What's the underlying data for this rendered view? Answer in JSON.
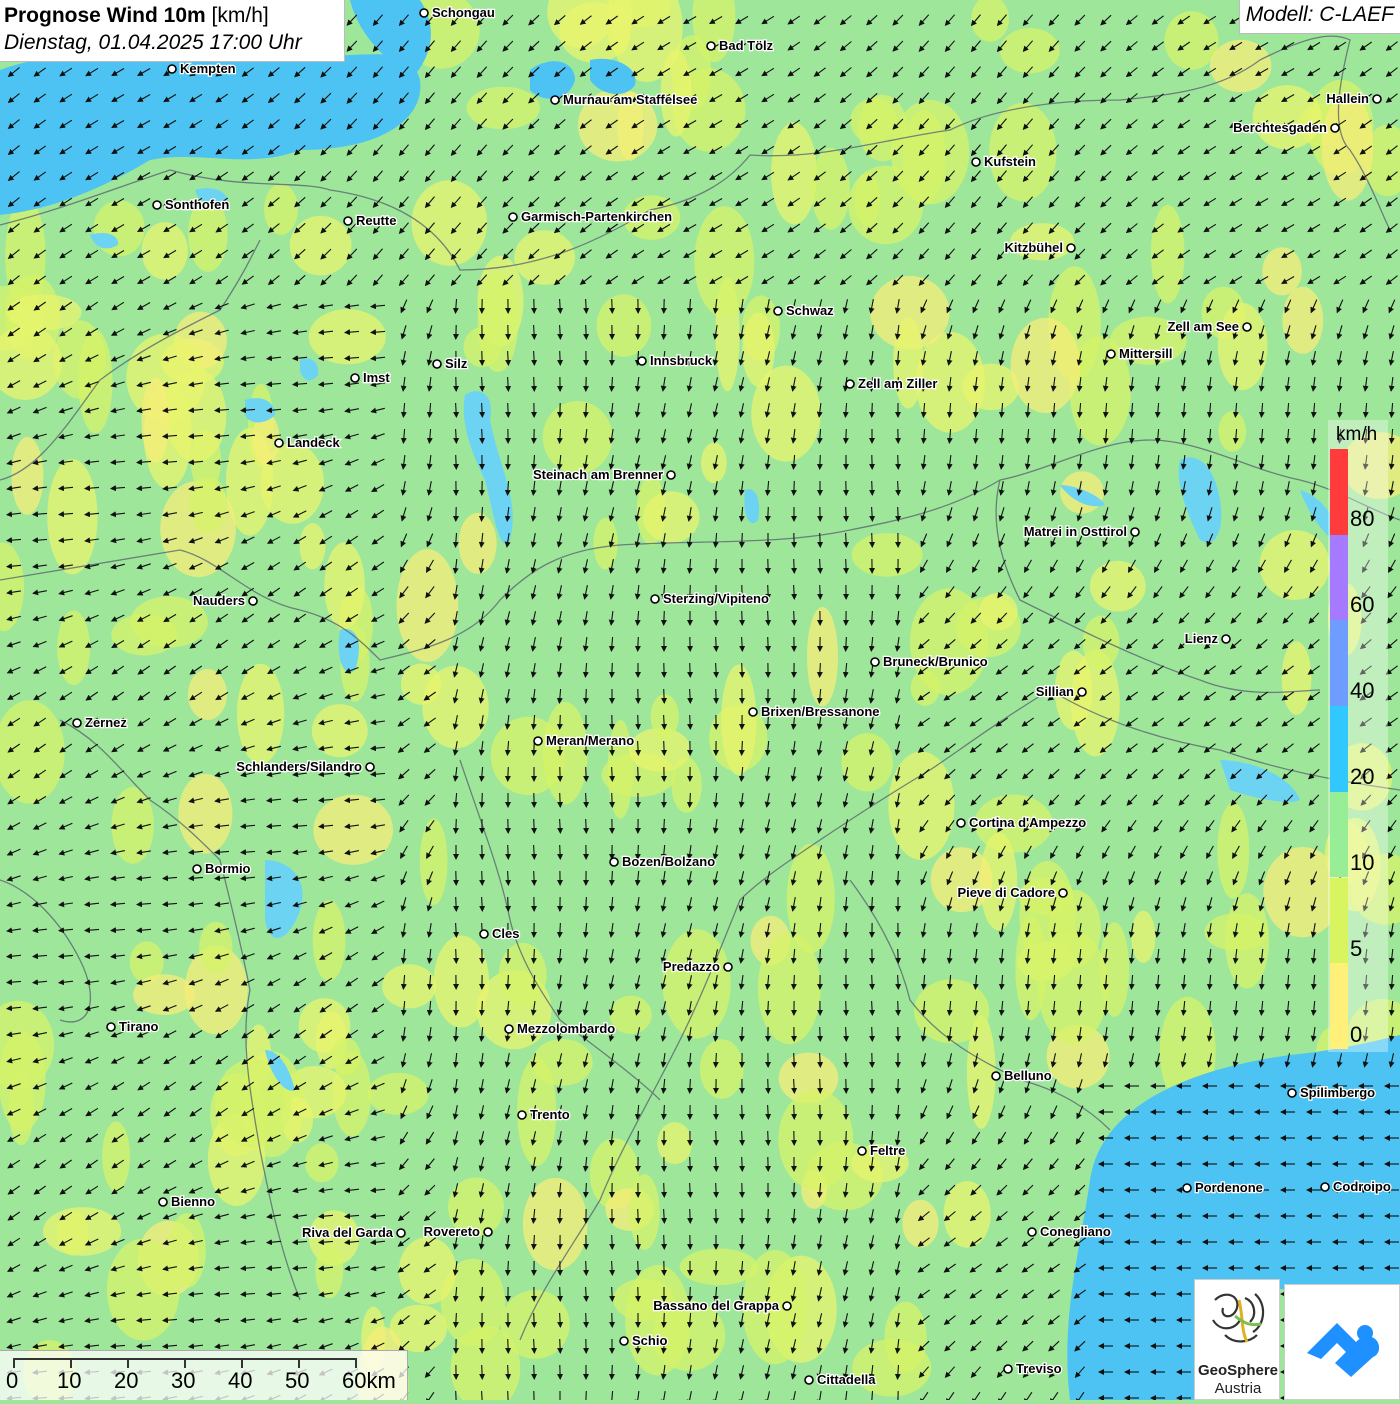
{
  "title": {
    "main": "Prognose Wind 10m",
    "unit": "[km/h]",
    "date": "Dienstag, 01.04.2025 17:00 Uhr"
  },
  "model": "Modell: C-LAEF",
  "legend": {
    "unit": "km/h",
    "labels": [
      "80",
      "60",
      "40",
      "20",
      "10",
      "5",
      "0"
    ],
    "colors": [
      "#ff3b3b",
      "#a67aff",
      "#6e9cff",
      "#30c8ff",
      "#98ee96",
      "#d8f560",
      "#fff07a"
    ]
  },
  "scale": {
    "labels": [
      "0",
      "10",
      "20",
      "30",
      "40",
      "50",
      "60km"
    ]
  },
  "logos": {
    "geosphere_line1": "GeoSphere",
    "geosphere_line2": "Austria"
  },
  "cities": [
    {
      "name": "Schongau"
    },
    {
      "name": "Kempten"
    },
    {
      "name": "Bad Tölz"
    },
    {
      "name": "Murnau am Staffelsee"
    },
    {
      "name": "Hallein"
    },
    {
      "name": "Berchtesgaden"
    },
    {
      "name": "Kufstein"
    },
    {
      "name": "Sonthofen"
    },
    {
      "name": "Reutte"
    },
    {
      "name": "Garmisch-Partenkirchen"
    },
    {
      "name": "Kitzbühel"
    },
    {
      "name": "Schwaz"
    },
    {
      "name": "Zell am See"
    },
    {
      "name": "Mittersill"
    },
    {
      "name": "Innsbruck"
    },
    {
      "name": "Silz"
    },
    {
      "name": "Imst"
    },
    {
      "name": "Zell am Ziller"
    },
    {
      "name": "Landeck"
    },
    {
      "name": "Steinach am Brenner"
    },
    {
      "name": "Matrei in Osttirol"
    },
    {
      "name": "Nauders"
    },
    {
      "name": "Sterzing/Vipiteno"
    },
    {
      "name": "Lienz"
    },
    {
      "name": "Bruneck/Brunico"
    },
    {
      "name": "Sillian"
    },
    {
      "name": "Brixen/Bressanone"
    },
    {
      "name": "Zernez"
    },
    {
      "name": "Meran/Merano"
    },
    {
      "name": "Schlanders/Silandro"
    },
    {
      "name": "Cortina d'Ampezzo"
    },
    {
      "name": "Bozen/Bolzano"
    },
    {
      "name": "Bormio"
    },
    {
      "name": "Pieve di Cadore"
    },
    {
      "name": "Cles"
    },
    {
      "name": "Predazzo"
    },
    {
      "name": "Tirano"
    },
    {
      "name": "Mezzolombardo"
    },
    {
      "name": "Belluno"
    },
    {
      "name": "Spilimbergo"
    },
    {
      "name": "Trento"
    },
    {
      "name": "Feltre"
    },
    {
      "name": "Pordenone"
    },
    {
      "name": "Codroipo"
    },
    {
      "name": "Bienno"
    },
    {
      "name": "Riva del Garda"
    },
    {
      "name": "Rovereto"
    },
    {
      "name": "Conegliano"
    },
    {
      "name": "Bassano del Grappa"
    },
    {
      "name": "Schio"
    },
    {
      "name": "Treviso"
    },
    {
      "name": "Cittadella"
    }
  ]
}
